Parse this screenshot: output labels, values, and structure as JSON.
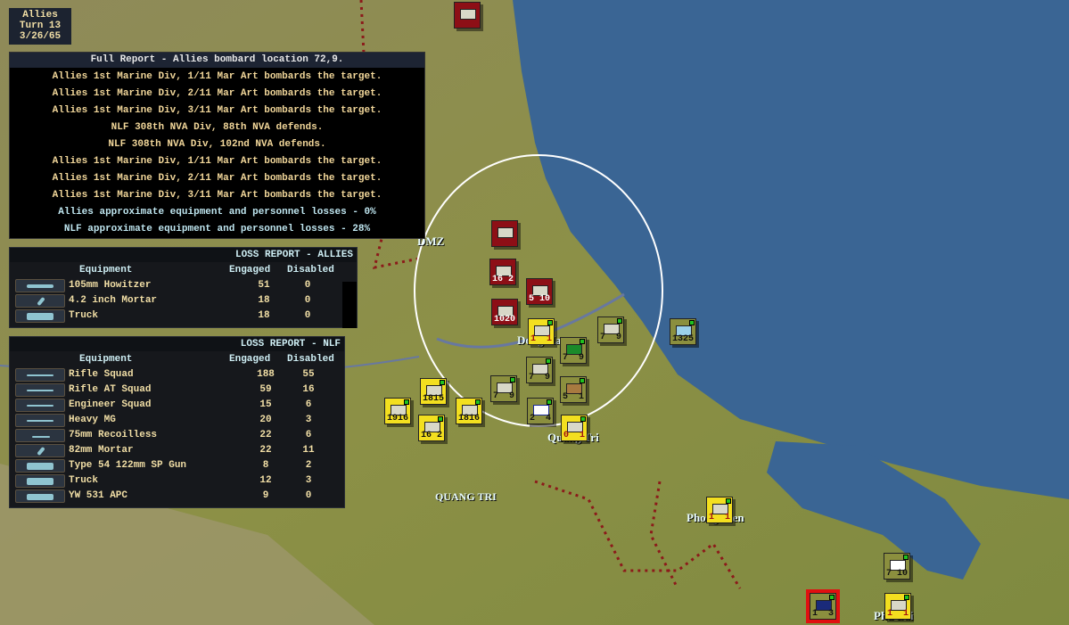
{
  "turn": {
    "side": "Allies",
    "turn": "Turn 13",
    "date": "3/26/65"
  },
  "full_report": {
    "title": "Full Report -  Allies bombard location 72,9.",
    "lines": [
      "Allies 1st Marine Div, 1/11 Mar Art bombards the target.",
      "Allies 1st Marine Div, 2/11 Mar Art bombards the target.",
      "Allies 1st Marine Div, 3/11 Mar Art bombards the target.",
      "NLF 308th NVA Div, 88th NVA defends.",
      "NLF 308th NVA Div, 102nd NVA defends.",
      "Allies 1st Marine Div, 1/11 Mar Art bombards the target.",
      "Allies 1st Marine Div, 2/11 Mar Art bombards the target.",
      "Allies 1st Marine Div, 3/11 Mar Art bombards the target."
    ],
    "allies_losses": "Allies approximate equipment and personnel losses - 0%",
    "nlf_losses": "NLF approximate equipment and personnel losses - 28%"
  },
  "loss_allies": {
    "title": "LOSS REPORT -  ALLIES",
    "col_equipment": "Equipment",
    "col_engaged": "Engaged",
    "col_disabled": "Disabled",
    "rows": [
      {
        "name": "105mm Howitzer",
        "engaged": "51",
        "disabled": "0",
        "icon": "howitzer-icon"
      },
      {
        "name": "4.2 inch Mortar",
        "engaged": "18",
        "disabled": "0",
        "icon": "mortar-icon"
      },
      {
        "name": "Truck",
        "engaged": "18",
        "disabled": "0",
        "icon": "truck-icon"
      }
    ]
  },
  "loss_nlf": {
    "title": "LOSS REPORT -  NLF",
    "col_equipment": "Equipment",
    "col_engaged": "Engaged",
    "col_disabled": "Disabled",
    "rows": [
      {
        "name": "Rifle Squad",
        "engaged": "188",
        "disabled": "55",
        "icon": "rifle-icon"
      },
      {
        "name": "Rifle AT Squad",
        "engaged": "59",
        "disabled": "16",
        "icon": "rifle-icon"
      },
      {
        "name": "Engineer Squad",
        "engaged": "15",
        "disabled": "6",
        "icon": "rifle-icon"
      },
      {
        "name": "Heavy MG",
        "engaged": "20",
        "disabled": "3",
        "icon": "machine-gun-icon"
      },
      {
        "name": "75mm Recoilless",
        "engaged": "22",
        "disabled": "6",
        "icon": "recoilless-icon"
      },
      {
        "name": "82mm Mortar",
        "engaged": "22",
        "disabled": "11",
        "icon": "mortar-icon"
      },
      {
        "name": "Type 54 122mm SP Gun",
        "engaged": "8",
        "disabled": "2",
        "icon": "sp-gun-icon"
      },
      {
        "name": "Truck",
        "engaged": "12",
        "disabled": "3",
        "icon": "truck-icon"
      },
      {
        "name": "YW 531 APC",
        "engaged": "9",
        "disabled": "0",
        "icon": "apc-icon"
      }
    ]
  },
  "map_labels": {
    "dmz": "DMZ",
    "dong_ha": "Dong Ha",
    "quang_tri_city": "Quang Tri",
    "quang_tri_prov": "QUANG TRI",
    "phong_dien": "Phong Dien",
    "phu_bai": "Phu Bai"
  },
  "counters": [
    {
      "a": "",
      "b": ""
    },
    {
      "a": "",
      "b": ""
    },
    {
      "a": "16",
      "b": "2"
    },
    {
      "a": "5",
      "b": "10"
    },
    {
      "a": "10",
      "b": "20"
    },
    {
      "a": "1",
      "b": "1"
    },
    {
      "a": "7",
      "b": "9"
    },
    {
      "a": "7",
      "b": "9"
    },
    {
      "a": "7",
      "b": "9"
    },
    {
      "a": "7",
      "b": "9"
    },
    {
      "a": "5",
      "b": "1"
    },
    {
      "a": "2",
      "b": "4"
    },
    {
      "a": "0",
      "b": "1"
    },
    {
      "a": "18",
      "b": "15"
    },
    {
      "a": "19",
      "b": "16"
    },
    {
      "a": "18",
      "b": "16"
    },
    {
      "a": "16",
      "b": "2"
    },
    {
      "a": "13",
      "b": "25"
    },
    {
      "a": "1",
      "b": "1"
    },
    {
      "a": "7",
      "b": "10"
    },
    {
      "a": "1",
      "b": "3"
    },
    {
      "a": "1",
      "b": "1"
    }
  ]
}
